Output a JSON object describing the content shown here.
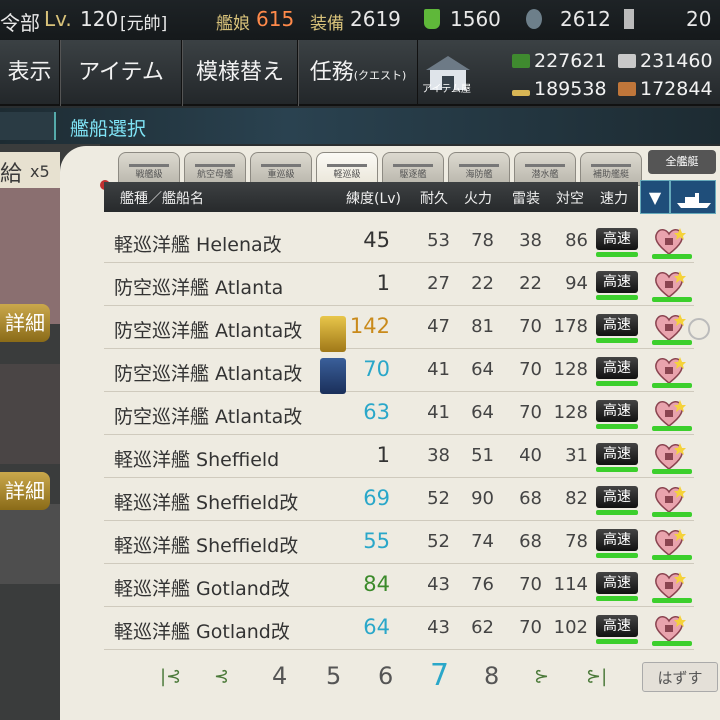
{
  "topbar": {
    "commander": "令部",
    "lv_label": "Lv.",
    "level": "120",
    "rank": "[元帥]",
    "ships_label": "艦娘",
    "ships_count": "615",
    "equip_label": "装備",
    "equip_count": "2619",
    "bucket": "1560",
    "devmat": "2612",
    "screw": "20"
  },
  "menu": {
    "display": "表示",
    "items": "アイテム",
    "remodel": "模様替え",
    "quest": "任務",
    "quest_sub": "(クエスト)",
    "shop": "アイテム屋"
  },
  "resources": {
    "fuel": "227621",
    "ammo": "231460",
    "steel": "189538",
    "bauxite": "172844"
  },
  "title": "艦船選択",
  "left_panel": {
    "supply_text": "給",
    "count_text": "x5",
    "detail_label": "詳細"
  },
  "tabs": [
    "戦艦級",
    "航空母艦",
    "重巡級",
    "軽巡級",
    "駆逐艦",
    "海防艦",
    "潜水艦",
    "補助艦艇"
  ],
  "all_ships_label": "全艦艇",
  "header": {
    "type_name": "艦種／艦船名",
    "lv": "練度(Lv)",
    "hp": "耐久",
    "fp": "火力",
    "torp": "雷装",
    "aa": "対空",
    "speed": "速力"
  },
  "rows": [
    {
      "name": "軽巡洋艦 Helena改",
      "lv": "45",
      "hp": "53",
      "fp": "78",
      "torp": "38",
      "aa": "86",
      "speed": "高速",
      "lv_color": "#333333"
    },
    {
      "name": "防空巡洋艦 Atlanta",
      "lv": "1",
      "hp": "27",
      "fp": "22",
      "torp": "22",
      "aa": "94",
      "speed": "高速",
      "lv_color": "#333333"
    },
    {
      "name": "防空巡洋艦 Atlanta改",
      "lv": "142",
      "hp": "47",
      "fp": "81",
      "torp": "70",
      "aa": "178",
      "speed": "高速",
      "lv_color": "#c98a1a"
    },
    {
      "name": "防空巡洋艦 Atlanta改",
      "lv": "70",
      "hp": "41",
      "fp": "64",
      "torp": "70",
      "aa": "128",
      "speed": "高速",
      "lv_color": "#2aa7c9"
    },
    {
      "name": "防空巡洋艦 Atlanta改",
      "lv": "63",
      "hp": "41",
      "fp": "64",
      "torp": "70",
      "aa": "128",
      "speed": "高速",
      "lv_color": "#2aa7c9"
    },
    {
      "name": "軽巡洋艦 Sheffield",
      "lv": "1",
      "hp": "38",
      "fp": "51",
      "torp": "40",
      "aa": "31",
      "speed": "高速",
      "lv_color": "#333333"
    },
    {
      "name": "軽巡洋艦 Sheffield改",
      "lv": "69",
      "hp": "52",
      "fp": "90",
      "torp": "68",
      "aa": "82",
      "speed": "高速",
      "lv_color": "#2aa7c9"
    },
    {
      "name": "軽巡洋艦 Sheffield改",
      "lv": "55",
      "hp": "52",
      "fp": "74",
      "torp": "68",
      "aa": "78",
      "speed": "高速",
      "lv_color": "#2aa7c9"
    },
    {
      "name": "軽巡洋艦 Gotland改",
      "lv": "84",
      "hp": "43",
      "fp": "76",
      "torp": "70",
      "aa": "114",
      "speed": "高速",
      "lv_color": "#3b8a2a"
    },
    {
      "name": "軽巡洋艦 Gotland改",
      "lv": "64",
      "hp": "43",
      "fp": "62",
      "torp": "70",
      "aa": "102",
      "speed": "高速",
      "lv_color": "#2aa7c9"
    }
  ],
  "pager": {
    "pages": [
      "4",
      "5",
      "6",
      "7",
      "8"
    ],
    "current": "7"
  },
  "remove_label": "はずす",
  "colors": {
    "accent": "#2aa7c9",
    "title_text": "#7fe3f5",
    "speed_bar": "#3ccf2c"
  }
}
